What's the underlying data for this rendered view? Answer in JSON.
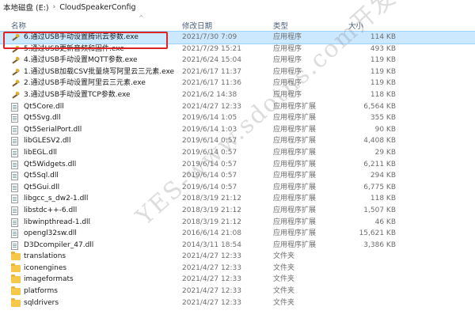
{
  "breadcrumb": {
    "drive": "本地磁盘 (E:)",
    "folder": "CloudSpeakerConfig",
    "separator": "›"
  },
  "columns": {
    "name": "名称",
    "date": "修改日期",
    "type": "类型",
    "size": "大小"
  },
  "files": [
    {
      "icon": "tool-exe-icon",
      "name": "6.通过USB手动设置腾讯云参数.exe",
      "date": "2021/7/30 7:09",
      "type": "应用程序",
      "size": "114 KB",
      "selected": true
    },
    {
      "icon": "tool-exe-icon",
      "name": "5.通过USB更新音频和固件.exe",
      "date": "2021/7/29 15:21",
      "type": "应用程序",
      "size": "493 KB"
    },
    {
      "icon": "tool-exe-icon",
      "name": "4.通过USB手动设置MQTT参数.exe",
      "date": "2021/6/24 15:04",
      "type": "应用程序",
      "size": "119 KB"
    },
    {
      "icon": "tool-exe-icon",
      "name": "1.通过USB加载CSV批量烧写阿里云三元素.exe",
      "date": "2021/6/17 11:37",
      "type": "应用程序",
      "size": "119 KB"
    },
    {
      "icon": "tool-exe-icon",
      "name": "2.通过USB手动设置阿里云三元素.exe",
      "date": "2021/6/17 11:36",
      "type": "应用程序",
      "size": "119 KB"
    },
    {
      "icon": "tool-exe-icon",
      "name": "3.通过USB手动设置TCP参数.exe",
      "date": "2021/6/2 14:38",
      "type": "应用程序",
      "size": "118 KB"
    },
    {
      "icon": "dll-file-icon",
      "name": "Qt5Core.dll",
      "date": "2021/4/27 12:33",
      "type": "应用程序扩展",
      "size": "6,564 KB"
    },
    {
      "icon": "dll-file-icon",
      "name": "Qt5Svg.dll",
      "date": "2019/6/14 1:05",
      "type": "应用程序扩展",
      "size": "355 KB"
    },
    {
      "icon": "dll-file-icon",
      "name": "Qt5SerialPort.dll",
      "date": "2019/6/14 1:03",
      "type": "应用程序扩展",
      "size": "90 KB"
    },
    {
      "icon": "dll-file-icon",
      "name": "libGLESV2.dll",
      "date": "2019/6/14 0:57",
      "type": "应用程序扩展",
      "size": "4,408 KB"
    },
    {
      "icon": "dll-file-icon",
      "name": "libEGL.dll",
      "date": "2019/6/14 0:57",
      "type": "应用程序扩展",
      "size": "29 KB"
    },
    {
      "icon": "dll-file-icon",
      "name": "Qt5Widgets.dll",
      "date": "2019/6/14 0:57",
      "type": "应用程序扩展",
      "size": "6,211 KB"
    },
    {
      "icon": "dll-file-icon",
      "name": "Qt5Sql.dll",
      "date": "2019/6/14 0:57",
      "type": "应用程序扩展",
      "size": "294 KB"
    },
    {
      "icon": "dll-file-icon",
      "name": "Qt5Gui.dll",
      "date": "2019/6/14 0:57",
      "type": "应用程序扩展",
      "size": "6,775 KB"
    },
    {
      "icon": "dll-file-icon",
      "name": "libgcc_s_dw2-1.dll",
      "date": "2018/3/19 21:12",
      "type": "应用程序扩展",
      "size": "118 KB"
    },
    {
      "icon": "dll-file-icon",
      "name": "libstdc++-6.dll",
      "date": "2018/3/19 21:12",
      "type": "应用程序扩展",
      "size": "1,507 KB"
    },
    {
      "icon": "dll-file-icon",
      "name": "libwinpthread-1.dll",
      "date": "2018/3/19 21:12",
      "type": "应用程序扩展",
      "size": "46 KB"
    },
    {
      "icon": "dll-file-icon",
      "name": "opengl32sw.dll",
      "date": "2016/6/14 21:08",
      "type": "应用程序扩展",
      "size": "15,621 KB"
    },
    {
      "icon": "dll-file-icon",
      "name": "D3Dcompiler_47.dll",
      "date": "2014/3/11 18:54",
      "type": "应用程序扩展",
      "size": "3,386 KB"
    },
    {
      "icon": "folder-icon",
      "name": "translations",
      "date": "2021/4/27 12:33",
      "type": "文件夹",
      "size": ""
    },
    {
      "icon": "folder-icon",
      "name": "iconengines",
      "date": "2021/4/27 12:33",
      "type": "文件夹",
      "size": ""
    },
    {
      "icon": "folder-icon",
      "name": "imageformats",
      "date": "2021/4/27 12:33",
      "type": "文件夹",
      "size": ""
    },
    {
      "icon": "folder-icon",
      "name": "platforms",
      "date": "2021/4/27 12:33",
      "type": "文件夹",
      "size": ""
    },
    {
      "icon": "folder-icon",
      "name": "sqldrivers",
      "date": "2021/4/27 12:33",
      "type": "文件夹",
      "size": ""
    }
  ],
  "watermark": "YES-www.sdotns.com开发测试",
  "colors": {
    "selection": "#cce8ff",
    "highlight": "#e02424",
    "folder": "#f6c84a"
  }
}
